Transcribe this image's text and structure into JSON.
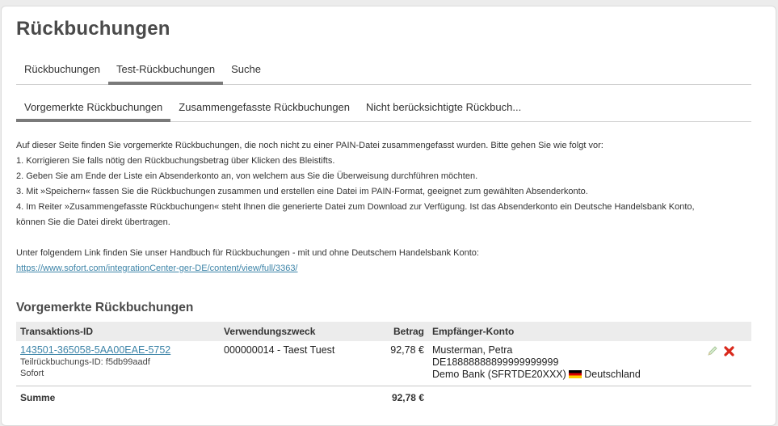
{
  "page": {
    "title": "Rückbuchungen"
  },
  "tabs_primary": [
    {
      "label": "Rückbuchungen"
    },
    {
      "label": "Test-Rückbuchungen"
    },
    {
      "label": "Suche"
    }
  ],
  "tabs_secondary": [
    {
      "label": "Vorgemerkte Rückbuchungen"
    },
    {
      "label": "Zusammengefasste Rückbuchungen"
    },
    {
      "label": "Nicht berücksichtigte Rückbuch..."
    }
  ],
  "description": {
    "intro": "Auf dieser Seite finden Sie vorgemerkte Rückbuchungen, die noch nicht zu einer PAIN-Datei zusammengefasst wurden. Bitte gehen Sie wie folgt vor:",
    "steps": [
      "1. Korrigieren Sie falls nötig den Rückbuchungsbetrag über Klicken des Bleistifts.",
      "2. Geben Sie am Ende der Liste ein Absenderkonto an, von welchem aus Sie die Überweisung durchführen möchten.",
      "3. Mit »Speichern« fassen Sie die Rückbuchungen zusammen und erstellen eine Datei im PAIN-Format, geeignet zum gewählten Absenderkonto.",
      "4. Im Reiter »Zusammengefasste Rückbuchungen« steht Ihnen die generierte Datei zum Download zur Verfügung. Ist das Absenderkonto ein Deutsche Handelsbank Konto,",
      "können Sie die Datei direkt übertragen."
    ],
    "handbook_text": "Unter folgendem Link finden Sie unser Handbuch für Rückbuchungen - mit und ohne Deutschem Handelsbank Konto:",
    "handbook_link": "https://www.sofort.com/integrationCenter-ger-DE/content/view/full/3363/"
  },
  "section": {
    "title": "Vorgemerkte Rückbuchungen"
  },
  "table": {
    "headers": {
      "transaction_id": "Transaktions-ID",
      "purpose": "Verwendungszweck",
      "amount": "Betrag",
      "recipient": "Empfänger-Konto"
    },
    "rows": [
      {
        "transaction_id": "143501-365058-5AA00EAE-5752",
        "partial_id": "Teilrückbuchungs-ID: f5db99aadf",
        "provider": "Sofort",
        "purpose": "000000014 - Taest Tuest",
        "amount": "92,78 €",
        "recipient_name": "Musterman, Petra",
        "recipient_iban": "DE18888888899999999999",
        "recipient_bank": "Demo Bank (SFRTDE20XXX)",
        "recipient_country": "Deutschland",
        "icons": {
          "edit": "pencil-icon",
          "delete": "delete-x-icon"
        }
      }
    ],
    "sum": {
      "label": "Summe",
      "amount": "92,78 €"
    }
  },
  "colors": {
    "link": "#3d84a8",
    "active_tab_underline": "#7a7a7a",
    "delete_icon": "#d9291c",
    "header_bg": "#ececec"
  }
}
